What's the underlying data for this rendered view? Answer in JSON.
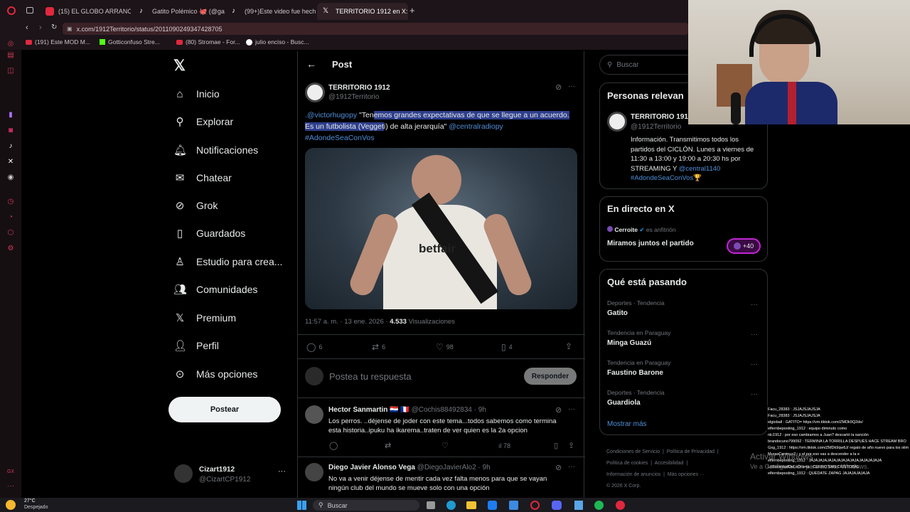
{
  "browser": {
    "tabs": [
      {
        "title": "(15) EL GLOBO ARRANCÓ",
        "icon": "youtube-icon",
        "color": "#e0283e"
      },
      {
        "title": "Gatito Polémico 🐙 (@gal",
        "icon": "tiktok-icon",
        "color": "#ffffff"
      },
      {
        "title": "(99+)Este video fue hech",
        "icon": "tiktok-icon",
        "color": "#ffffff"
      },
      {
        "title": "TERRITORIO 1912 en X: \"",
        "icon": "x-icon",
        "color": "#ffffff"
      }
    ],
    "url": "x.com/1912Territorio/status/2011090249347428705",
    "bookmarks": [
      {
        "label": "(191) Este MOD M...",
        "icon": "youtube-icon"
      },
      {
        "label": "Gotticonfuso Stre...",
        "icon": "kick-icon"
      },
      {
        "label": "(80) Stromae - For...",
        "icon": "youtube-icon"
      },
      {
        "label": "julio enciso - Busc...",
        "icon": "google-icon"
      }
    ]
  },
  "nav": {
    "items": [
      "Inicio",
      "Explorar",
      "Notificaciones",
      "Chatear",
      "Grok",
      "Guardados",
      "Estudio para crea...",
      "Comunidades",
      "Premium",
      "Perfil",
      "Más opciones"
    ],
    "post_button": "Postear",
    "account_name": "Cizart1912",
    "account_handle": "@CizartCP1912"
  },
  "header": {
    "title": "Post"
  },
  "tweet": {
    "author": "TERRITORIO 1912",
    "handle": "@1912Territorio",
    "mention": ".@victorhugopy",
    "text_pre": " \"Ten",
    "text_hl": "emos grandes expectativas de que se llegue a un acuerdo. Es un futbolista (Vegget",
    "text_post": "i) de alta jerarquía\" ",
    "mention2": "@centralradiopy",
    "hashtag": "#AdondeSeaConVos",
    "image_text": "betfair",
    "time": "11:57 a. m. · 13 ene. 2026 · ",
    "views": "4.533",
    "views_label": " Visualizaciones",
    "replies": "6",
    "retweets": "6",
    "likes": "98",
    "bookmarks": "4"
  },
  "reply_box": {
    "placeholder": "Postea tu respuesta",
    "button": "Responder"
  },
  "replies": [
    {
      "name": "Hector Sanmartin 🇵🇾 🇫🇷",
      "handle": "@Cochis88492834 · 9h",
      "text1": "Los perros. ..déjense de joder con este tema...todos sabemos como termina",
      "text2": "esta historia..ipuku ha ikarema..traten de ver quien es la 2a opcion",
      "views": "78"
    },
    {
      "name": "Diego Javier Alonso Vega",
      "handle": "@DiegoJavierAlo2 · 9h",
      "text1": "No va a venir déjense de mentir cada vez falta menos para que se vayan",
      "text2": "ningún club del mundo se mueve solo con una opción"
    }
  ],
  "search": {
    "placeholder": "Buscar"
  },
  "relevant": {
    "title": "Personas relevan",
    "name": "TERRITORIO 1912",
    "handle": "@1912Territorio",
    "bio": [
      "Información. Transmitimos todos los",
      "partidos del CICLÓN. Lunes a viernes de",
      "11:30 a 13:00 y 19:00 a 20:30 hs por",
      "STREAMING Y "
    ],
    "bio_link": "@central1140",
    "bio_tag": "#AdondeSeaConVos🏆"
  },
  "live": {
    "title": "En directo en X",
    "host": "Cerroite",
    "host_suffix": "es anfitrión",
    "space": "Miramos juntos el partido",
    "count": "+40"
  },
  "trends": {
    "title": "Qué está pasando",
    "items": [
      {
        "context": "Deportes · Tendencia",
        "name": "Gatito"
      },
      {
        "context": "Tendencia en Paraguay",
        "name": "Minga Guazú"
      },
      {
        "context": "Tendencia en Paraguay",
        "name": "Faustino Barone"
      },
      {
        "context": "Deportes · Tendencia",
        "name": "Guardiola"
      }
    ],
    "more": "Mostrar más"
  },
  "footer": [
    "Condiciones de Servicio",
    "Política de Privacidad",
    "Política de cookies",
    "Accesibilidad",
    "Información de anuncios",
    "Más opciones ···",
    "© 2026 X Corp."
  ],
  "activate": {
    "line1": "Activar Windows",
    "line2": "Ve a Configuración para activar Windows."
  },
  "chat": [
    "Facu_28383 : JSJAJSJAJSJA",
    "Facu_28383 : JSJAJSJAJSJA",
    "elgioball : GATITO= https://vm.tiktok.com/ZMDk9Q2de/",
    "elfernbeposting_1912 : equipo diminuto como",
    "nlc1912 : por eso cambiamos a Juan? descartó la sanción",
    "brandocuno799092 : TERMINA LA TORRILLA DESPUÉS HACE STREAM BRO",
    "Gxg_1912 : https://vm.tiktok.com/ZMDk9qw6J/ regalo de año nuevo para los olimpistas",
    "MurasCorrinus2 : y el por eso vas a descender a la e",
    "elfernbeposting_1912 : JAJAJAJAJAJAJAJAJAJAJAJAJAJAJAJA",
    "LoSociedadDeLoDrama : CERRO SAN CRISTOBAL",
    "elfernbeposting_1912 : QUEDATE ZAPAG JAJAJAJAJAJA"
  ],
  "taskbar": {
    "temp": "27°C",
    "weather": "Despejado",
    "search": "Buscar"
  }
}
